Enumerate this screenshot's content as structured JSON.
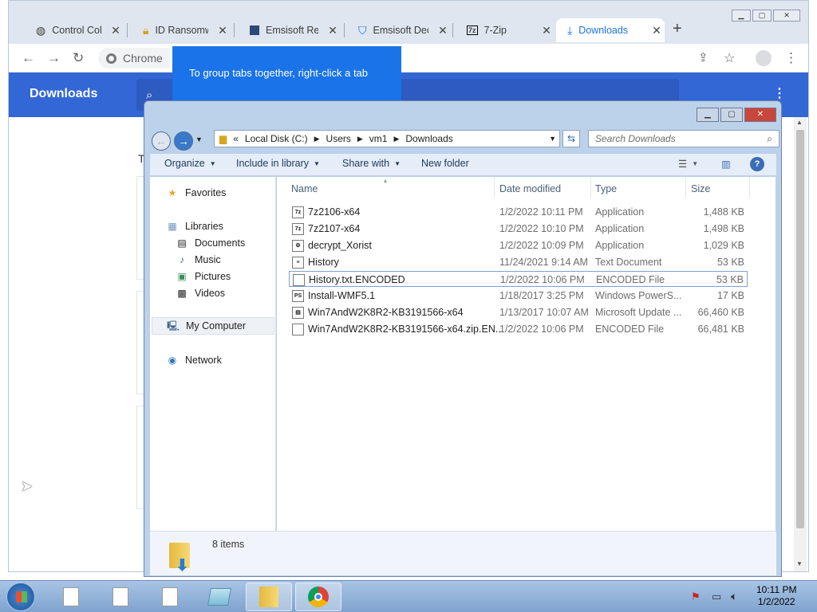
{
  "browser": {
    "tabs": [
      {
        "title": "Control Colla",
        "icon": "globe-icon"
      },
      {
        "title": "ID Ransomwa",
        "icon": "lock-icon"
      },
      {
        "title": "Emsisoft Rele",
        "icon": "emsisoft-icon"
      },
      {
        "title": "Emsisoft Dec",
        "icon": "shield-icon"
      },
      {
        "title": "7-Zip",
        "icon": "7zip-icon"
      },
      {
        "title": "Downloads",
        "icon": "download-icon",
        "active": true
      }
    ],
    "omnibox_label": "Chrome",
    "tooltip": "To group tabs together, right-click a tab",
    "downloads_title": "Downloads",
    "partial_text": "T"
  },
  "explorer": {
    "breadcrumb": [
      "«",
      "Local Disk (C:)",
      "Users",
      "vm1",
      "Downloads"
    ],
    "search_placeholder": "Search Downloads",
    "commands": {
      "organize": "Organize",
      "include": "Include in library",
      "share": "Share with",
      "newfolder": "New folder"
    },
    "nav": {
      "favorites": "Favorites",
      "libraries": "Libraries",
      "documents": "Documents",
      "music": "Music",
      "pictures": "Pictures",
      "videos": "Videos",
      "computer": "My Computer",
      "network": "Network"
    },
    "columns": {
      "name": "Name",
      "date": "Date modified",
      "type": "Type",
      "size": "Size"
    },
    "files": [
      {
        "name": "7z2106-x64",
        "date": "1/2/2022 10:11 PM",
        "type": "Application",
        "size": "1,488 KB",
        "icon": "7z"
      },
      {
        "name": "7z2107-x64",
        "date": "1/2/2022 10:10 PM",
        "type": "Application",
        "size": "1,498 KB",
        "icon": "7z"
      },
      {
        "name": "decrypt_Xorist",
        "date": "1/2/2022 10:09 PM",
        "type": "Application",
        "size": "1,029 KB",
        "icon": "exe"
      },
      {
        "name": "History",
        "date": "11/24/2021 9:14 AM",
        "type": "Text Document",
        "size": "53 KB",
        "icon": "txt"
      },
      {
        "name": "History.txt.ENCODED",
        "date": "1/2/2022 10:06 PM",
        "type": "ENCODED File",
        "size": "53 KB",
        "icon": "file",
        "selected": true
      },
      {
        "name": "Install-WMF5.1",
        "date": "1/18/2017 3:25 PM",
        "type": "Windows PowerS...",
        "size": "17 KB",
        "icon": "ps"
      },
      {
        "name": "Win7AndW2K8R2-KB3191566-x64",
        "date": "1/13/2017 10:07 AM",
        "type": "Microsoft Update ...",
        "size": "66,460 KB",
        "icon": "msu"
      },
      {
        "name": "Win7AndW2K8R2-KB3191566-x64.zip.EN...",
        "date": "1/2/2022 10:06 PM",
        "type": "ENCODED File",
        "size": "66,481 KB",
        "icon": "file"
      }
    ],
    "item_count": "8 items"
  },
  "taskbar": {
    "time": "10:11 PM",
    "date": "1/2/2022"
  }
}
